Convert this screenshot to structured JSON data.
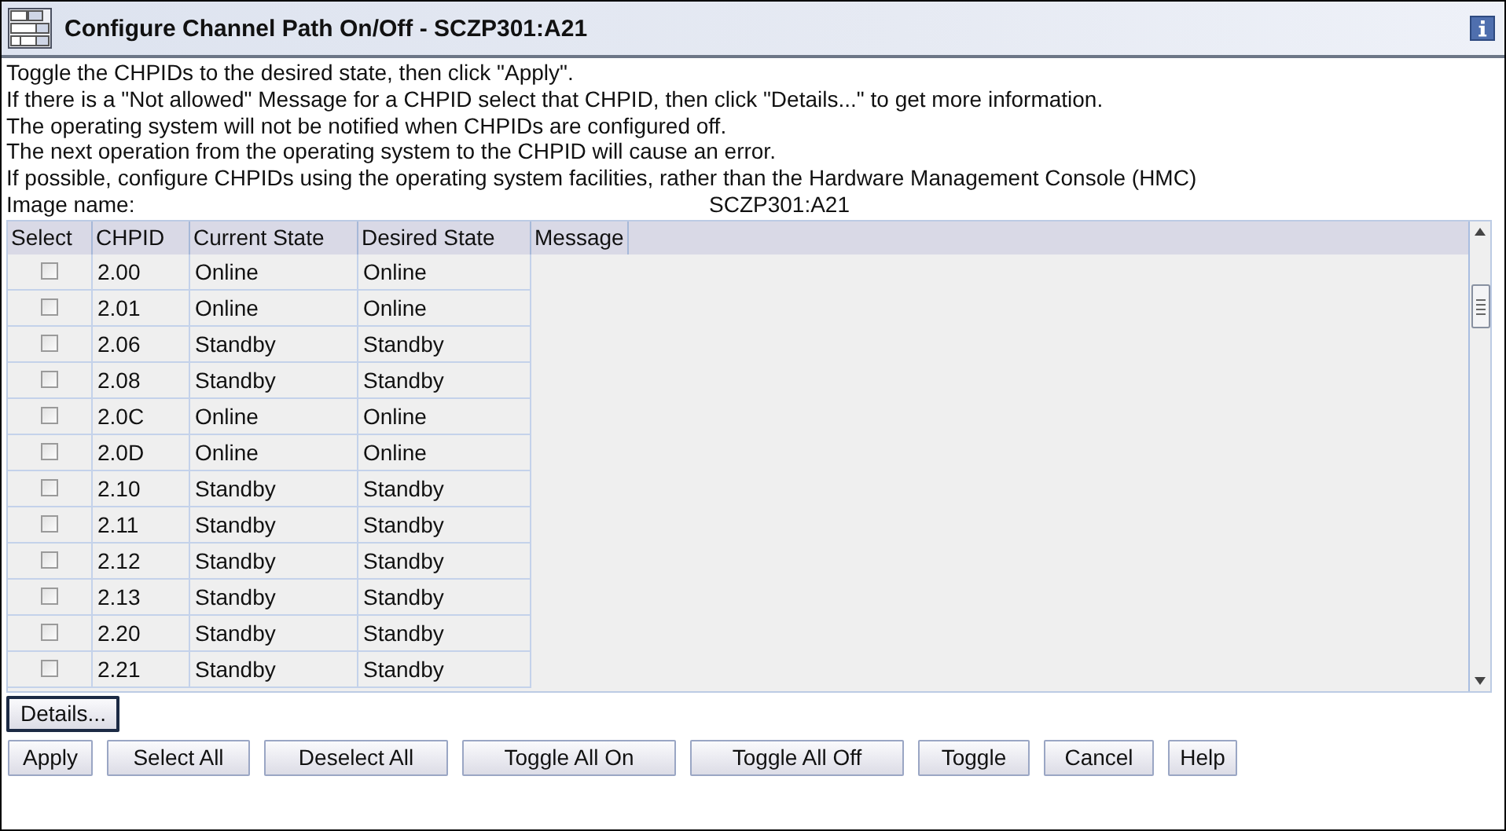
{
  "window": {
    "title": "Configure Channel Path On/Off - SCZP301:A21"
  },
  "instructions": [
    "Toggle the CHPIDs to the desired state, then click \"Apply\".",
    "If there is a \"Not allowed\" Message for a CHPID select that CHPID, then click \"Details...\" to get more information.",
    "The operating system will not be notified when CHPIDs are configured off.",
    "The next operation from the operating system to the CHPID will cause an error.",
    "If possible, configure CHPIDs using the operating system facilities, rather than the Hardware Management Console (HMC)"
  ],
  "image_name": {
    "label": "Image name:",
    "value": "SCZP301:A21"
  },
  "table": {
    "columns": [
      "Select",
      "CHPID",
      "Current State",
      "Desired State",
      "Message"
    ],
    "rows": [
      {
        "checked": false,
        "chpid": "2.00",
        "current_state": "Online",
        "desired_state": "Online"
      },
      {
        "checked": false,
        "chpid": "2.01",
        "current_state": "Online",
        "desired_state": "Online"
      },
      {
        "checked": false,
        "chpid": "2.06",
        "current_state": "Standby",
        "desired_state": "Standby"
      },
      {
        "checked": false,
        "chpid": "2.08",
        "current_state": "Standby",
        "desired_state": "Standby"
      },
      {
        "checked": false,
        "chpid": "2.0C",
        "current_state": "Online",
        "desired_state": "Online"
      },
      {
        "checked": false,
        "chpid": "2.0D",
        "current_state": "Online",
        "desired_state": "Online"
      },
      {
        "checked": false,
        "chpid": "2.10",
        "current_state": "Standby",
        "desired_state": "Standby"
      },
      {
        "checked": false,
        "chpid": "2.11",
        "current_state": "Standby",
        "desired_state": "Standby"
      },
      {
        "checked": false,
        "chpid": "2.12",
        "current_state": "Standby",
        "desired_state": "Standby"
      },
      {
        "checked": false,
        "chpid": "2.13",
        "current_state": "Standby",
        "desired_state": "Standby"
      },
      {
        "checked": false,
        "chpid": "2.20",
        "current_state": "Standby",
        "desired_state": "Standby"
      },
      {
        "checked": false,
        "chpid": "2.21",
        "current_state": "Standby",
        "desired_state": "Standby"
      }
    ]
  },
  "details_button": {
    "label": "Details...",
    "focused": true
  },
  "buttons": [
    "Apply",
    "Select All",
    "Deselect All",
    "Toggle All On",
    "Toggle All Off",
    "Toggle",
    "Cancel",
    "Help"
  ]
}
